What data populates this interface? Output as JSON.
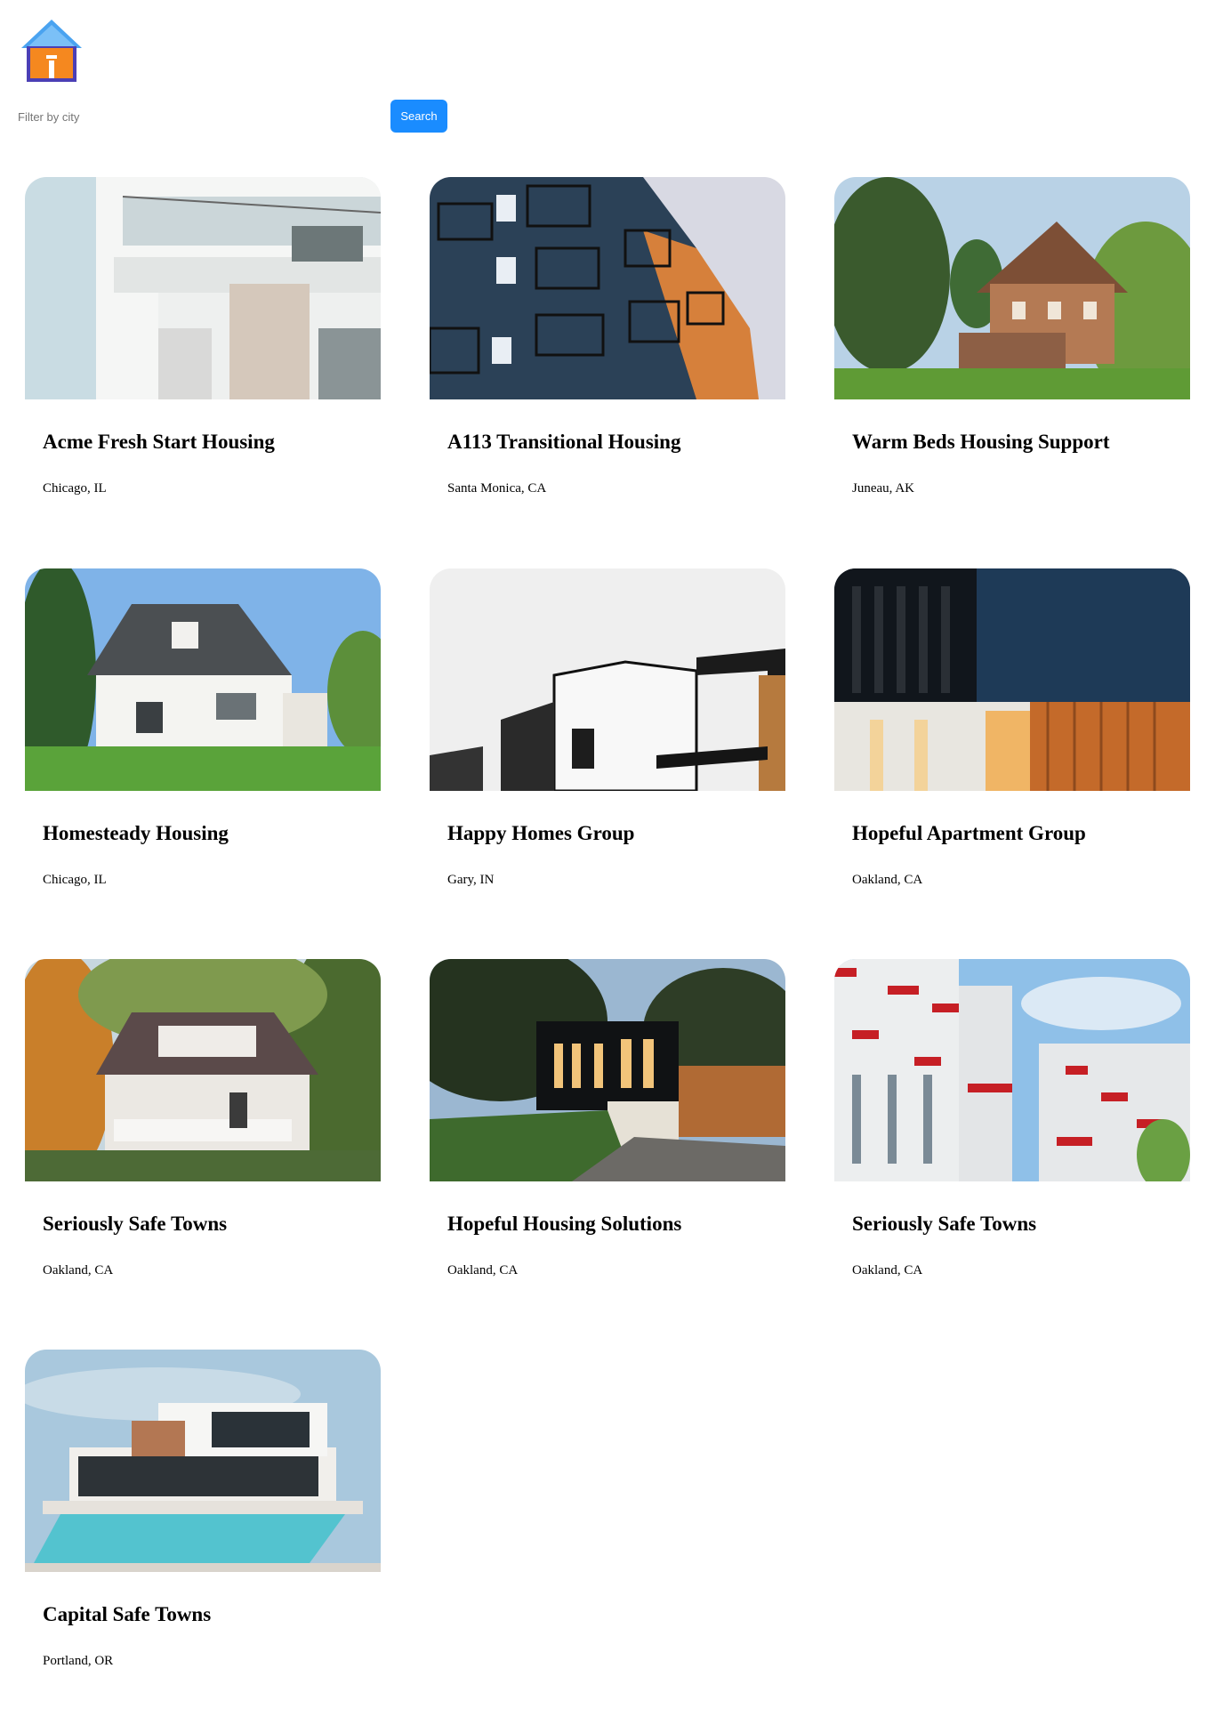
{
  "app": {
    "logo_icon": "house-icon",
    "colors": {
      "logo_roof": "#4aa3f0",
      "logo_body": "#f5881f",
      "logo_outline": "#4b3fb5",
      "accent": "#1a8cff"
    }
  },
  "search": {
    "placeholder": "Filter by city",
    "value": "",
    "button_label": "Search"
  },
  "listings": [
    {
      "title": "Acme Fresh Start Housing",
      "city": "Chicago, IL",
      "photo": "white modern apartment balconies"
    },
    {
      "title": "A113 Transitional Housing",
      "city": "Santa Monica, CA",
      "photo": "blue apartment building with balconies"
    },
    {
      "title": "Warm Beds Housing Support",
      "city": "Juneau, AK",
      "photo": "victorian house among trees"
    },
    {
      "title": "Homesteady Housing",
      "city": "Chicago, IL",
      "photo": "white suburban house with lawn"
    },
    {
      "title": "Happy Homes Group",
      "city": "Gary, IN",
      "photo": "minimalist white and black houses"
    },
    {
      "title": "Hopeful Apartment Group",
      "city": "Oakland, CA",
      "photo": "dark modern building with wood panels"
    },
    {
      "title": "Seriously Safe Towns",
      "city": "Oakland, CA",
      "photo": "craftsman house with porch in autumn"
    },
    {
      "title": "Hopeful Housing Solutions",
      "city": "Oakland, CA",
      "photo": "modern house at dusk with lights"
    },
    {
      "title": "Seriously Safe Towns",
      "city": "Oakland, CA",
      "photo": "red and white apartment towers"
    },
    {
      "title": "Capital Safe Towns",
      "city": "Portland, OR",
      "photo": "modern villa with pool"
    }
  ]
}
